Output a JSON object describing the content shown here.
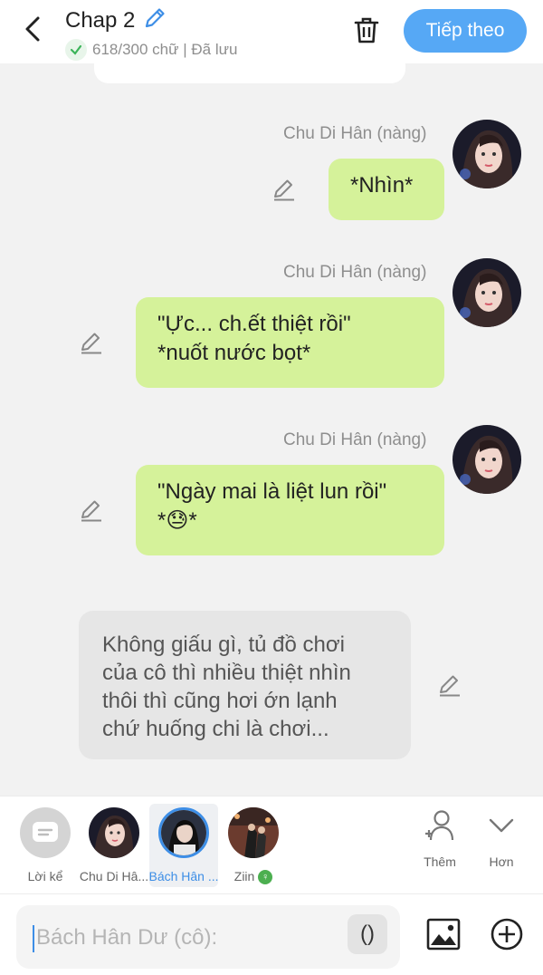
{
  "header": {
    "title": "Chap 2",
    "status": "618/300 chữ | Đã lưu",
    "next_label": "Tiếp theo"
  },
  "messages": [
    {
      "speaker": "Chu Di Hân (nàng)",
      "text": "*Nhìn*"
    },
    {
      "speaker": "Chu Di Hân (nàng)",
      "line1": "\"Ực... ch.ết thiệt rồi\"",
      "line2": "*nuốt nước bọt*"
    },
    {
      "speaker": "Chu Di Hân (nàng)",
      "line1": "\"Ngày mai là liệt lun rồi\"",
      "line2_prefix": "*",
      "emoji": "😓",
      "line2_suffix": "*"
    },
    {
      "lines": [
        "Không giấu gì, tủ đồ chơi",
        "của cô thì nhiều thiệt nhìn",
        "thôi thì cũng hơi ớn lạnh",
        "chứ huống chi là chơi..."
      ]
    }
  ],
  "characters": [
    {
      "label": "Lời kể"
    },
    {
      "label": "Chu Di Hâ..."
    },
    {
      "label": "Bách Hân ..."
    },
    {
      "label": "Ziin"
    }
  ],
  "actions": {
    "add_label": "Thêm",
    "more_label": "Hơn"
  },
  "input": {
    "placeholder": "Bách Hân Dư (cô):",
    "paren": "()"
  },
  "colors": {
    "accent": "#56a8f5",
    "bubble_green": "#d5f29a",
    "bubble_gray": "#e6e6e6"
  }
}
